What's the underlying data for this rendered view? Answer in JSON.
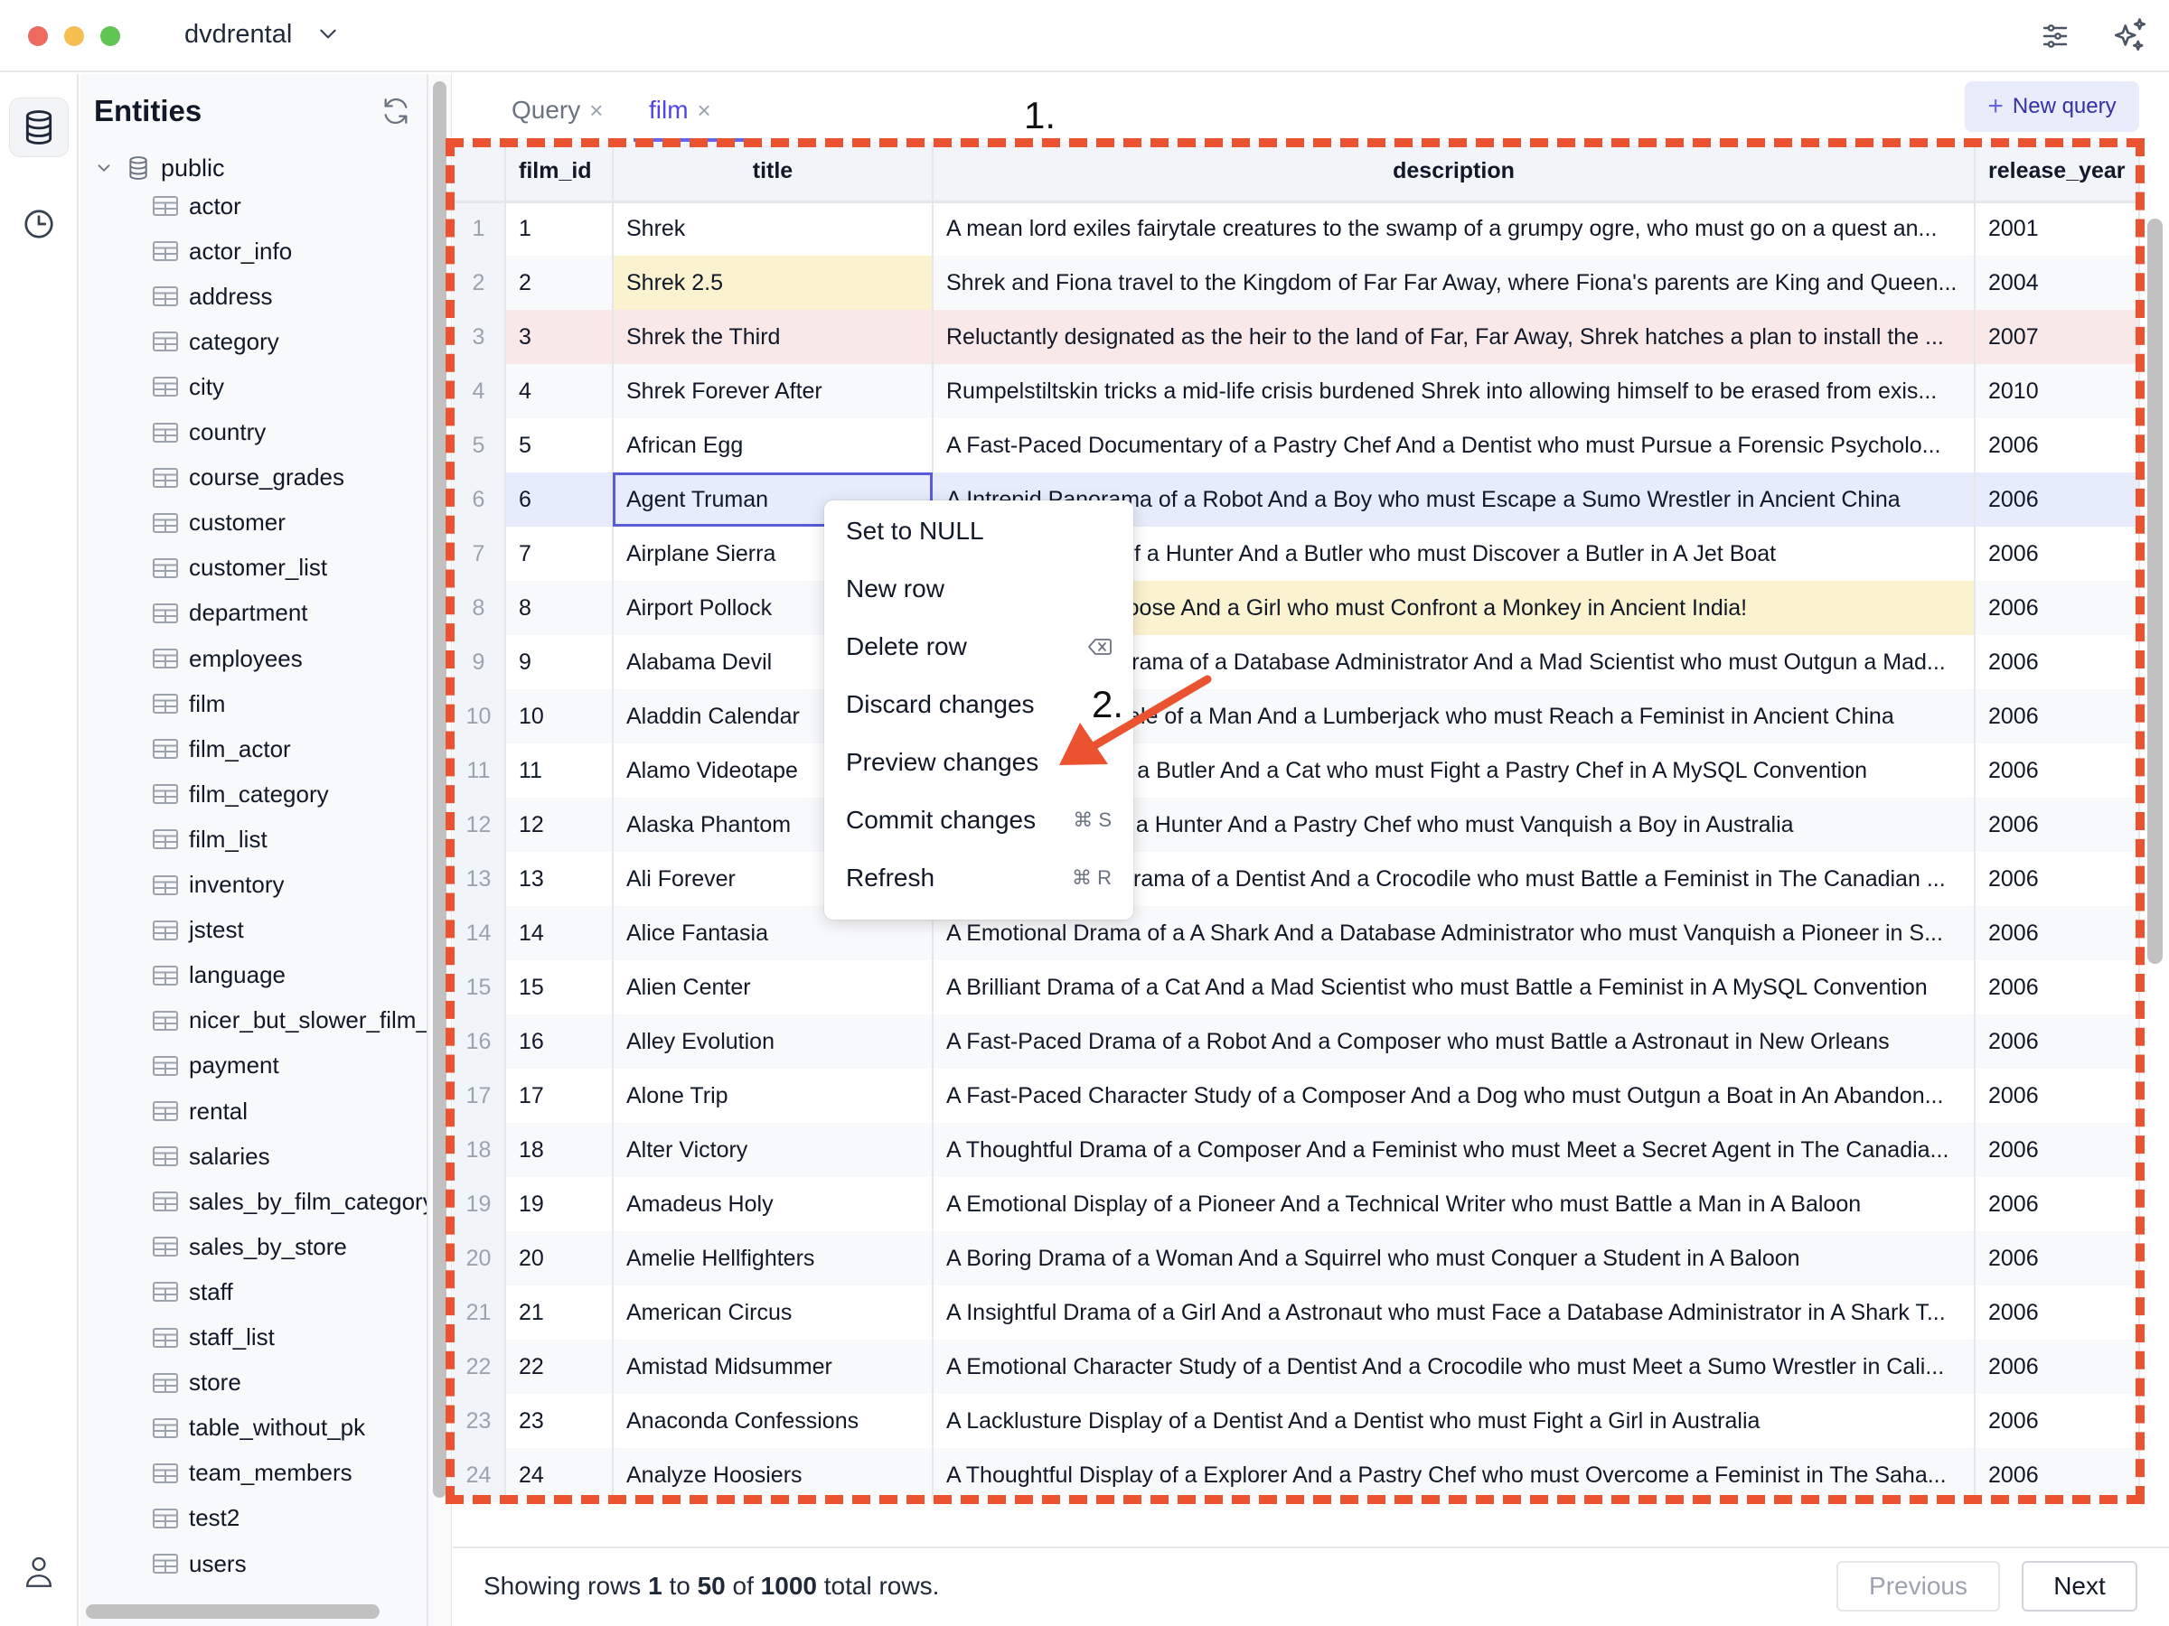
{
  "window": {
    "database_name": "dvdrental",
    "traffic_lights": {
      "close": "#ec6a5e",
      "minimize": "#f4bf4f",
      "maximize": "#61c554"
    },
    "icons": {
      "settings": "sliders-icon",
      "ai": "sparkles-icon"
    }
  },
  "rail": {
    "items": [
      {
        "name": "entities",
        "icon": "database-icon",
        "active": true
      },
      {
        "name": "history",
        "icon": "clock-icon",
        "active": false
      }
    ],
    "bottom_icon": "user-icon"
  },
  "sidebar": {
    "title": "Entities",
    "refresh_icon": "refresh-icon",
    "schema": {
      "name": "public",
      "expanded": true
    },
    "tables": [
      "actor",
      "actor_info",
      "address",
      "category",
      "city",
      "country",
      "course_grades",
      "customer",
      "customer_list",
      "department",
      "employees",
      "film",
      "film_actor",
      "film_category",
      "film_list",
      "inventory",
      "jstest",
      "language",
      "nicer_but_slower_film_list",
      "payment",
      "rental",
      "salaries",
      "sales_by_film_category",
      "sales_by_store",
      "staff",
      "staff_list",
      "store",
      "table_without_pk",
      "team_members",
      "test2",
      "users"
    ]
  },
  "tabs": [
    {
      "label": "Query",
      "active": false,
      "close": "×"
    },
    {
      "label": "film",
      "active": true,
      "close": "×"
    }
  ],
  "new_query_label": "New query",
  "grid": {
    "columns": [
      "film_id",
      "title",
      "description",
      "release_year"
    ],
    "rows": [
      {
        "n": "1",
        "film_id": "1",
        "title": "Shrek",
        "description": "A mean lord exiles fairytale creatures to the swamp of a grumpy ogre, who must go on a quest an...",
        "release_year": "2001",
        "state": ""
      },
      {
        "n": "2",
        "film_id": "2",
        "title": "Shrek 2.5",
        "description": "Shrek and Fiona travel to the Kingdom of Far Far Away, where Fiona's parents are King and Queen...",
        "release_year": "2004",
        "state": "edited-title"
      },
      {
        "n": "3",
        "film_id": "3",
        "title": "Shrek the Third",
        "description": "Reluctantly designated as the heir to the land of Far, Far Away, Shrek hatches a plan to install the ...",
        "release_year": "2007",
        "state": "deleted"
      },
      {
        "n": "4",
        "film_id": "4",
        "title": "Shrek Forever After",
        "description": "Rumpelstiltskin tricks a mid-life crisis burdened Shrek into allowing himself to be erased from exis...",
        "release_year": "2010",
        "state": ""
      },
      {
        "n": "5",
        "film_id": "5",
        "title": "African Egg",
        "description": "A Fast-Paced Documentary of a Pastry Chef And a Dentist who must Pursue a Forensic Psycholo...",
        "release_year": "2006",
        "state": ""
      },
      {
        "n": "6",
        "film_id": "6",
        "title": "Agent Truman",
        "description": "A Intrepid Panorama of a Robot And a Boy who must Escape a Sumo Wrestler in Ancient China",
        "release_year": "2006",
        "state": "selected"
      },
      {
        "n": "7",
        "film_id": "7",
        "title": "Airplane Sierra",
        "description": "A Touching Saga of a Hunter And a Butler who must Discover a Butler in A Jet Boat",
        "release_year": "2006",
        "state": ""
      },
      {
        "n": "8",
        "film_id": "8",
        "title": "Airport Pollock",
        "description": "A Epic Tale of a Moose And a Girl who must Confront a Monkey in Ancient India!",
        "release_year": "2006",
        "state": "edited-description"
      },
      {
        "n": "9",
        "film_id": "9",
        "title": "Alabama Devil",
        "description": "A Thoughtful Panorama of a Database Administrator And a Mad Scientist who must Outgun a Mad...",
        "release_year": "2006",
        "state": ""
      },
      {
        "n": "10",
        "film_id": "10",
        "title": "Aladdin Calendar",
        "description": "A Action-Packed Tale of a Man And a Lumberjack who must Reach a Feminist in Ancient China",
        "release_year": "2006",
        "state": ""
      },
      {
        "n": "11",
        "film_id": "11",
        "title": "Alamo Videotape",
        "description": "A Boring Epistle of a Butler And a Cat who must Fight a Pastry Chef in A MySQL Convention",
        "release_year": "2006",
        "state": ""
      },
      {
        "n": "12",
        "film_id": "12",
        "title": "Alaska Phantom",
        "description": "A Fanciful Saga of a Hunter And a Pastry Chef who must Vanquish a Boy in Australia",
        "release_year": "2006",
        "state": ""
      },
      {
        "n": "13",
        "film_id": "13",
        "title": "Ali Forever",
        "description": "A Action-Packed Drama of a Dentist And a Crocodile who must Battle a Feminist in The Canadian ...",
        "release_year": "2006",
        "state": ""
      },
      {
        "n": "14",
        "film_id": "14",
        "title": "Alice Fantasia",
        "description": "A Emotional Drama of a A Shark And a Database Administrator who must Vanquish a Pioneer in S...",
        "release_year": "2006",
        "state": ""
      },
      {
        "n": "15",
        "film_id": "15",
        "title": "Alien Center",
        "description": "A Brilliant Drama of a Cat And a Mad Scientist who must Battle a Feminist in A MySQL Convention",
        "release_year": "2006",
        "state": ""
      },
      {
        "n": "16",
        "film_id": "16",
        "title": "Alley Evolution",
        "description": "A Fast-Paced Drama of a Robot And a Composer who must Battle a Astronaut in New Orleans",
        "release_year": "2006",
        "state": ""
      },
      {
        "n": "17",
        "film_id": "17",
        "title": "Alone Trip",
        "description": "A Fast-Paced Character Study of a Composer And a Dog who must Outgun a Boat in An Abandon...",
        "release_year": "2006",
        "state": ""
      },
      {
        "n": "18",
        "film_id": "18",
        "title": "Alter Victory",
        "description": "A Thoughtful Drama of a Composer And a Feminist who must Meet a Secret Agent in The Canadia...",
        "release_year": "2006",
        "state": ""
      },
      {
        "n": "19",
        "film_id": "19",
        "title": "Amadeus Holy",
        "description": "A Emotional Display of a Pioneer And a Technical Writer who must Battle a Man in A Baloon",
        "release_year": "2006",
        "state": ""
      },
      {
        "n": "20",
        "film_id": "20",
        "title": "Amelie Hellfighters",
        "description": "A Boring Drama of a Woman And a Squirrel who must Conquer a Student in A Baloon",
        "release_year": "2006",
        "state": ""
      },
      {
        "n": "21",
        "film_id": "21",
        "title": "American Circus",
        "description": "A Insightful Drama of a Girl And a Astronaut who must Face a Database Administrator in A Shark T...",
        "release_year": "2006",
        "state": ""
      },
      {
        "n": "22",
        "film_id": "22",
        "title": "Amistad Midsummer",
        "description": "A Emotional Character Study of a Dentist And a Crocodile who must Meet a Sumo Wrestler in Cali...",
        "release_year": "2006",
        "state": ""
      },
      {
        "n": "23",
        "film_id": "23",
        "title": "Anaconda Confessions",
        "description": "A Lacklusture Display of a Dentist And a Dentist who must Fight a Girl in Australia",
        "release_year": "2006",
        "state": ""
      },
      {
        "n": "24",
        "film_id": "24",
        "title": "Analyze Hoosiers",
        "description": "A Thoughtful Display of a Explorer And a Pastry Chef who must Overcome a Feminist in The Saha...",
        "release_year": "2006",
        "state": ""
      }
    ],
    "state_colors": {
      "edited": "#fbf2cf",
      "deleted": "#f9e8e8",
      "selected": "#e6ecfb",
      "active_cell_border": "#5b5bd6"
    }
  },
  "context_menu": {
    "items": [
      {
        "label": "Set to NULL",
        "shortcut": ""
      },
      {
        "label": "New row",
        "shortcut": ""
      },
      {
        "label": "Delete row",
        "shortcut": "⌫"
      },
      {
        "label": "Discard changes",
        "shortcut": ""
      },
      {
        "label": "Preview changes",
        "shortcut": ""
      },
      {
        "label": "Commit changes",
        "shortcut": "⌘ S"
      },
      {
        "label": "Refresh",
        "shortcut": "⌘ R"
      }
    ]
  },
  "footer": {
    "prefix": "Showing rows ",
    "from": "1",
    "to_word": " to ",
    "to": "50",
    "of_word": " of ",
    "total": "1000",
    "suffix": " total rows.",
    "previous_label": "Previous",
    "previous_disabled": true,
    "next_label": "Next"
  },
  "annotations": {
    "step1_label": "1.",
    "step2_label": "2.",
    "color": "#ea5230"
  }
}
